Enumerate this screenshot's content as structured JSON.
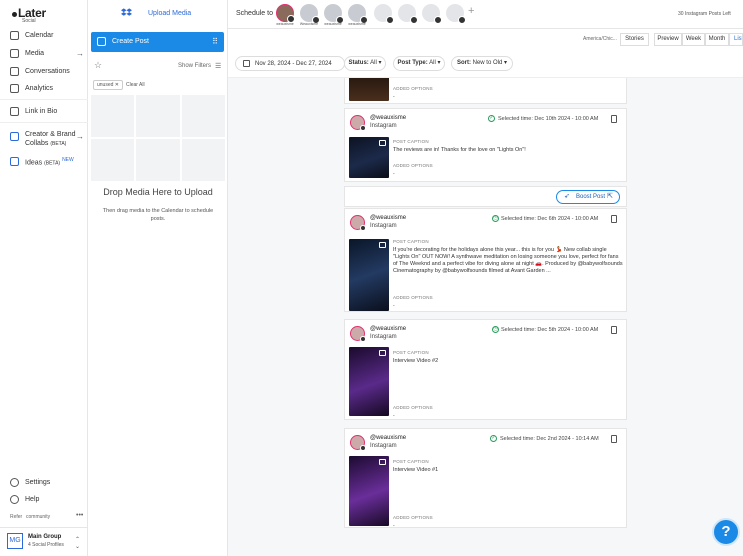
{
  "brand": {
    "name": "Later",
    "sub": "Social"
  },
  "nav": {
    "items": [
      {
        "label": "Calendar"
      },
      {
        "label": "Media"
      },
      {
        "label": "Conversations"
      },
      {
        "label": "Analytics"
      },
      {
        "label": "Link in Bio"
      },
      {
        "label": "Creator & Brand",
        "label2": "Collabs",
        "beta": "(BETA)"
      },
      {
        "label": "Ideas",
        "beta": "(BETA)",
        "badge": "NEW"
      }
    ],
    "settings": "Settings",
    "help": "Help",
    "refer": "Refer",
    "community": "community",
    "more": "•••",
    "group": {
      "initials": "MG",
      "name": "Main Group",
      "profiles": "4 Social Profiles"
    }
  },
  "media_panel": {
    "upload_label": "Upload Media",
    "create_post": "Create Post",
    "show_filters": "Show Filters",
    "tag": "unused",
    "tag_close": "✕",
    "clear_all": "Clear All",
    "drop_title": "Drop Media Here to Upload",
    "drop_sub": "Then drag media to the Calendar to schedule posts."
  },
  "topbar": {
    "schedule_to": "Schedule to",
    "profiles": [
      {
        "label": "weauxisme"
      },
      {
        "label": "Weauxisme"
      },
      {
        "label": "weauxisme"
      },
      {
        "label": "weauxisme"
      }
    ],
    "add_icon": "+",
    "posts_left": "30 Instagram Posts Left"
  },
  "views": {
    "timezone": "America/Chic...",
    "stories": "Stories",
    "preview": "Preview",
    "week": "Week",
    "month": "Month",
    "list": "List"
  },
  "filters": {
    "date_range": "Nov 28, 2024 - Dec 27, 2024",
    "status_label": "Status:",
    "status_value": "All",
    "post_type_label": "Post Type:",
    "post_type_value": "All",
    "sort_label": "Sort:",
    "sort_value": "New to Old"
  },
  "posts": [
    {
      "added_label": "ADDED OPTIONS",
      "added_value": "-"
    },
    {
      "handle": "@weauxisme",
      "network": "Instagram",
      "time": "Selected time: Dec 10th 2024 - 10:00 AM",
      "caption_label": "POST CAPTION",
      "caption": "The reviews are in! Thanks for the love on \"Lights On\"!",
      "added_label": "ADDED OPTIONS",
      "added_value": "-"
    },
    {
      "handle": "@weauxisme",
      "network": "Instagram",
      "time": "Selected time: Dec 6th 2024 - 10:00 AM",
      "caption_label": "POST CAPTION",
      "caption": "If you're decorating for the holidays alone this year... this is for you 💃 New collab single \"Lights On\" OUT NOW! A synthwave meditation on losing someone you love, perfect for fans of The Weeknd and a perfect vibe for diving alone at night 🚗. Produced by @babywolfsounds Cinematography by @babywolfsounds filmed at Avant Garden ...",
      "added_label": "ADDED OPTIONS",
      "added_value": "-"
    },
    {
      "handle": "@weauxisme",
      "network": "Instagram",
      "time": "Selected time: Dec 5th 2024 - 10:00 AM",
      "caption_label": "POST CAPTION",
      "caption": "Interview Video #2",
      "added_label": "ADDED OPTIONS",
      "added_value": "-"
    },
    {
      "handle": "@weauxisme",
      "network": "Instagram",
      "time": "Selected time: Dec 2nd 2024 - 10:14 AM",
      "caption_label": "POST CAPTION",
      "caption": "Interview Video #1",
      "added_label": "ADDED OPTIONS",
      "added_value": "-"
    }
  ],
  "boost": {
    "label": "Boost Post"
  },
  "help_fab": "?",
  "colors": {
    "accent": "#1b8ae6",
    "instagram": "#e1306c",
    "success": "#2a9d5c"
  }
}
